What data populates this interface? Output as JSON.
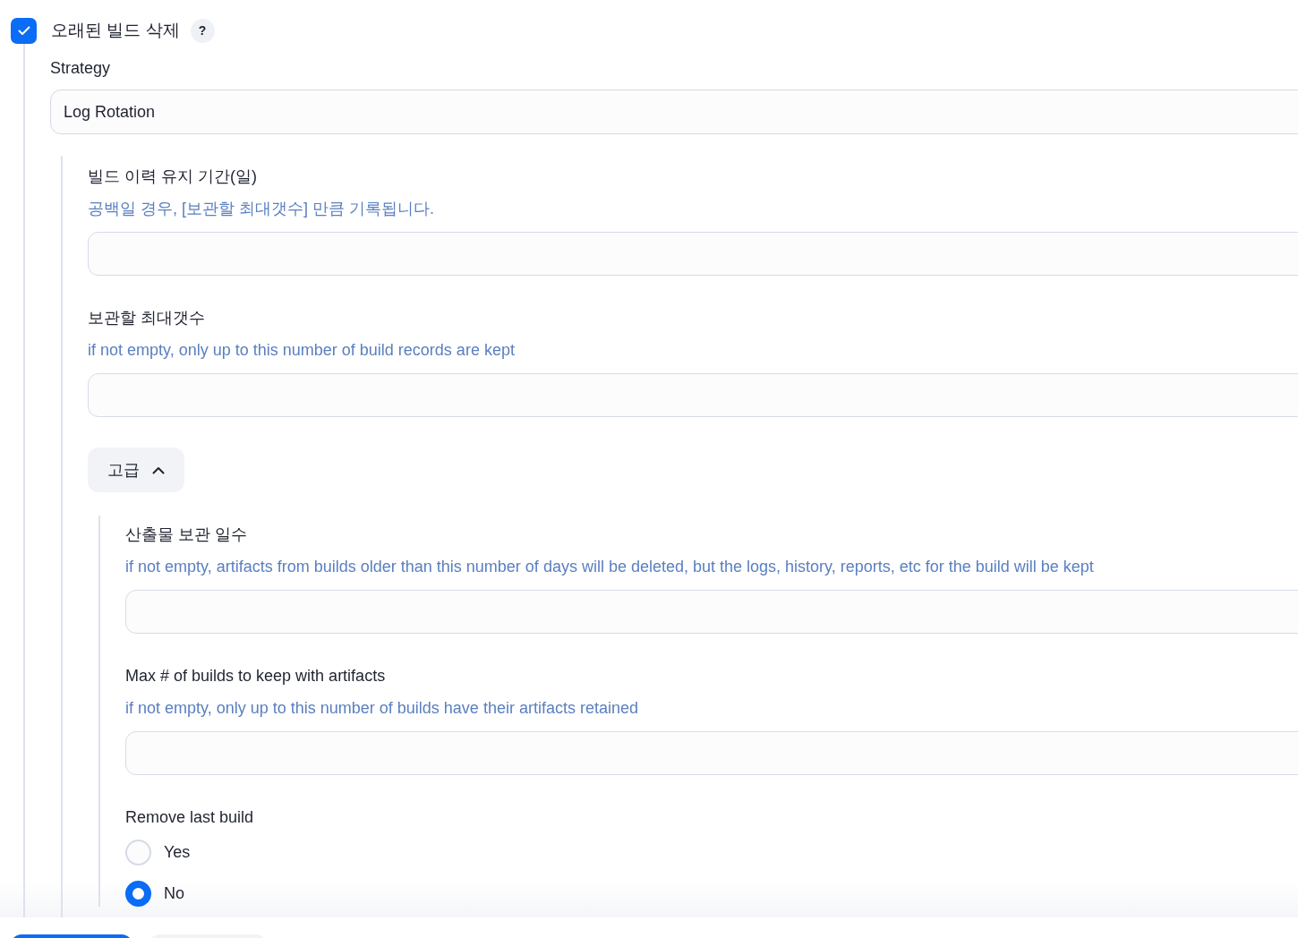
{
  "discard_old_builds": {
    "label": "오래된 빌드 삭제",
    "checked": true,
    "help": "?"
  },
  "strategy": {
    "label": "Strategy",
    "value": "Log Rotation"
  },
  "fields": [
    {
      "label": "빌드 이력 유지 기간(일)",
      "description": "공백일 경우, [보관할 최대갯수] 만큼 기록됩니다."
    },
    {
      "label": "보관할 최대갯수",
      "description": "if not empty, only up to this number of build records are kept"
    }
  ],
  "advanced": {
    "label": "고급",
    "expanded": true,
    "fields": [
      {
        "label": "산출물 보관 일수",
        "description": "if not empty, artifacts from builds older than this number of days will be deleted, but the logs, history, reports, etc for the build will be kept"
      },
      {
        "label": "Max # of builds to keep with artifacts",
        "description": "if not empty, only up to this number of builds have their artifacts retained"
      }
    ],
    "remove_last_build": {
      "label": "Remove last build",
      "options": [
        {
          "label": "Yes",
          "selected": false
        },
        {
          "label": "No",
          "selected": true
        }
      ]
    }
  }
}
